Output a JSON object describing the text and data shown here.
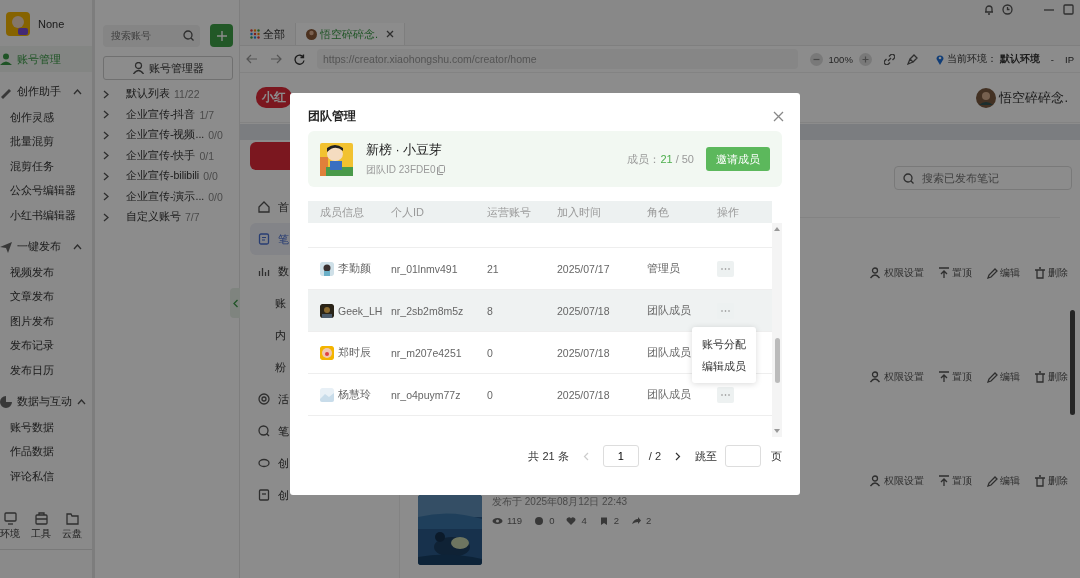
{
  "app_sidebar": {
    "user": {
      "name": "None"
    },
    "items": [
      {
        "label": "账号管理",
        "selected": true
      }
    ],
    "groups": [
      {
        "label": "创作助手",
        "expanded": true,
        "items": [
          "创作灵感",
          "批量混剪",
          "混剪任务",
          "公众号编辑器",
          "小红书编辑器"
        ]
      },
      {
        "label": "一键发布",
        "expanded": true,
        "items": [
          "视频发布",
          "文章发布",
          "图片发布",
          "发布记录",
          "发布日历"
        ]
      },
      {
        "label": "数据与互动",
        "expanded": true,
        "items": [
          "账号数据",
          "作品数据",
          "评论私信"
        ]
      }
    ],
    "tools": [
      "环境",
      "工具",
      "云盘"
    ]
  },
  "account_panel": {
    "search": {
      "placeholder": "搜索账号"
    },
    "manager_button": "账号管理器",
    "lists": [
      {
        "name": "默认列表",
        "count": "11/22",
        "expanded": false
      },
      {
        "name": "企业宣传-抖音",
        "count": "1/7",
        "expanded": false
      },
      {
        "name": "企业宣传-视频...",
        "count": "0/0",
        "expanded": false
      },
      {
        "name": "企业宣传-快手",
        "count": "0/1",
        "expanded": false
      },
      {
        "name": "企业宣传-bilibili",
        "count": "0/0",
        "expanded": false
      },
      {
        "name": "企业宣传-演示...",
        "count": "0/0",
        "expanded": false
      },
      {
        "name": "自定义账号",
        "count": "7/7",
        "expanded": false
      }
    ]
  },
  "browser": {
    "tabs": [
      {
        "label": "全部",
        "selected": false,
        "kind": "grid"
      },
      {
        "label": "悟空碎碎念.",
        "selected": true,
        "kind": "site"
      }
    ],
    "url": "https://creator.xiaohongshu.com/creator/home",
    "zoom": "100%",
    "env_label": "当前环境：",
    "env_value": "默认环境",
    "separator": "-",
    "ip": "IP"
  },
  "site": {
    "logo": "小红",
    "user": "悟空碎碎念.",
    "search_placeholder": "搜索已发布笔记",
    "nav": [
      {
        "label": "首",
        "kind": "item",
        "selected": false
      },
      {
        "label": "笔",
        "kind": "item",
        "selected": true
      },
      {
        "label": "数",
        "kind": "item",
        "selected": false
      },
      {
        "label": "账",
        "kind": "sub"
      },
      {
        "label": "内",
        "kind": "sub"
      },
      {
        "label": "粉",
        "kind": "sub"
      },
      {
        "label": "活",
        "kind": "item",
        "selected": false
      },
      {
        "label": "笔",
        "kind": "item",
        "selected": false
      },
      {
        "label": "创",
        "kind": "item",
        "selected": false
      },
      {
        "label": "创",
        "kind": "item",
        "selected": false
      }
    ],
    "posts": [
      {
        "actions": [
          "权限设置",
          "置顶",
          "编辑",
          "删除"
        ]
      },
      {
        "actions": [
          "权限设置",
          "置顶",
          "编辑",
          "删除"
        ]
      },
      {
        "actions": [
          "权限设置",
          "置顶",
          "编辑",
          "删除"
        ]
      },
      {
        "published": "发布于 2025年08月12日 22:43",
        "stats": [
          "119",
          "0",
          "4",
          "2",
          "2"
        ]
      }
    ]
  },
  "modal": {
    "title": "团队管理",
    "team": {
      "name": "新榜 · 小豆芽",
      "id_label": "团队ID 23FDE0",
      "members_label": "成员：",
      "members": "21",
      "limit": "/ 50",
      "invite_button": "邀请成员"
    },
    "columns": [
      "成员信息",
      "个人ID",
      "运营账号",
      "加入时间",
      "角色",
      "操作"
    ],
    "rows": [
      {
        "name": "李勤颜",
        "id": "nr_01lnmv491",
        "accounts": "21",
        "joined": "2025/07/17",
        "role": "管理员",
        "hovered": false
      },
      {
        "name": "Geek_LH",
        "id": "nr_2sb2m8m5z",
        "accounts": "8",
        "joined": "2025/07/18",
        "role": "团队成员",
        "hovered": true,
        "menu": [
          "账号分配",
          "编辑成员"
        ]
      },
      {
        "name": "郑时辰",
        "id": "nr_m207e4251",
        "accounts": "0",
        "joined": "2025/07/18",
        "role": "团队成员",
        "hovered": false
      },
      {
        "name": "杨慧玲",
        "id": "nr_o4puym77z",
        "accounts": "0",
        "joined": "2025/07/18",
        "role": "团队成员",
        "hovered": false
      }
    ],
    "pagination": {
      "total": "共 21 条",
      "prev_disabled": true,
      "page": "1",
      "pages": "/ 2",
      "next_disabled": false,
      "jump_label": "跳至",
      "page_unit": "页"
    }
  }
}
